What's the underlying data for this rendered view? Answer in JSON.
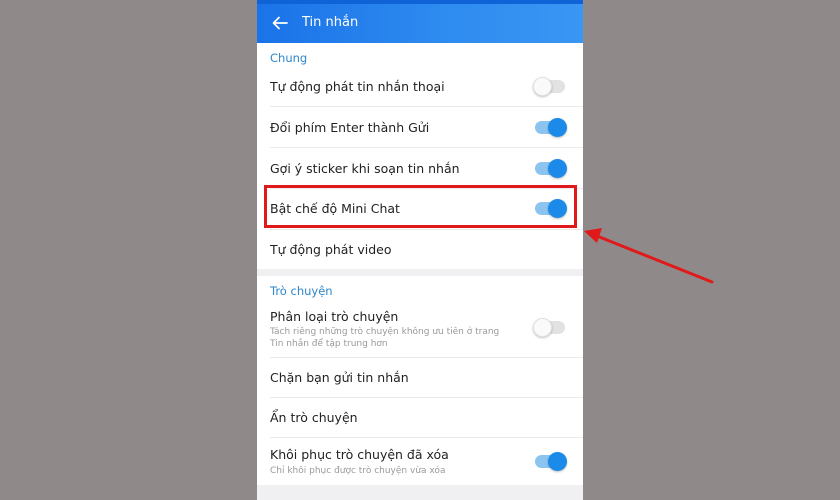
{
  "header": {
    "title": "Tin nhắn",
    "back_icon": "arrow-left-icon"
  },
  "section_general": {
    "title": "Chung",
    "items": [
      {
        "label": "Tự động phát tin nhắn thoại",
        "toggle": "off"
      },
      {
        "label": "Đổi phím Enter thành Gửi",
        "toggle": "on"
      },
      {
        "label": "Gợi ý sticker khi soạn tin nhắn",
        "toggle": "on"
      },
      {
        "label": "Bật chế độ Mini Chat",
        "toggle": "on"
      },
      {
        "label": "Tự động phát video"
      }
    ]
  },
  "section_chat": {
    "title": "Trò chuyện",
    "items": [
      {
        "label": "Phân loại trò chuyện",
        "sub": "Tách riêng những trò chuyện không ưu tiên ở trang Tin nhắn để tập trung hơn",
        "toggle": "off"
      },
      {
        "label": "Chặn bạn gửi tin nhắn"
      },
      {
        "label": "Ẩn trò chuyện"
      },
      {
        "label": "Khôi phục trò chuyện đã xóa",
        "sub": "Chỉ khôi phục được trò chuyện vừa xóa",
        "toggle": "on"
      }
    ]
  },
  "annotation": {
    "color": "#e01a1a"
  },
  "colors": {
    "accent": "#1b8ae8",
    "header": "#1a73e8"
  }
}
